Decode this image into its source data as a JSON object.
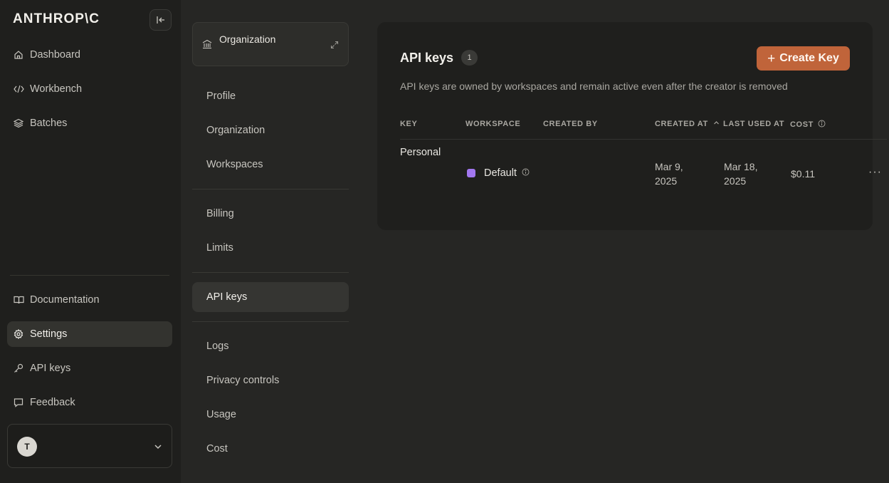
{
  "sidebar": {
    "logo": "ANTHROP\\C",
    "nav": [
      {
        "label": "Dashboard",
        "icon": "home-icon"
      },
      {
        "label": "Workbench",
        "icon": "code-icon"
      },
      {
        "label": "Batches",
        "icon": "layers-icon"
      },
      {
        "label": "Documentation",
        "icon": "book-icon"
      },
      {
        "label": "Settings",
        "icon": "gear-icon",
        "active": true
      },
      {
        "label": "API keys",
        "icon": "key-icon"
      },
      {
        "label": "Feedback",
        "icon": "message-icon"
      }
    ],
    "account": {
      "initial": "T"
    }
  },
  "settings_menu": {
    "org_card": {
      "title": "Organization"
    },
    "items": [
      {
        "label": "Profile"
      },
      {
        "label": "Organization"
      },
      {
        "label": "Workspaces"
      },
      {
        "label": "Billing"
      },
      {
        "label": "Limits"
      },
      {
        "label": "API keys",
        "active": true
      },
      {
        "label": "Logs"
      },
      {
        "label": "Privacy controls"
      },
      {
        "label": "Usage"
      },
      {
        "label": "Cost"
      }
    ]
  },
  "main": {
    "title": "API keys",
    "count": "1",
    "create_button": "Create Key",
    "description": "API keys are owned by workspaces and remain active even after the creator is removed",
    "columns": [
      "KEY",
      "WORKSPACE",
      "CREATED BY",
      "CREATED AT",
      "LAST USED AT",
      "COST"
    ],
    "rows": [
      {
        "key": "Personal",
        "workspace": "Default",
        "created_by": "",
        "created_at_line1": "Mar 9,",
        "created_at_line2": "2025",
        "last_used_line1": "Mar 18,",
        "last_used_line2": "2025",
        "cost": "$0.11"
      }
    ]
  },
  "colors": {
    "accent": "#c0643a",
    "workspace_dot": "#a277f0",
    "background": "#262624",
    "sidebar": "#1f1f1d"
  }
}
